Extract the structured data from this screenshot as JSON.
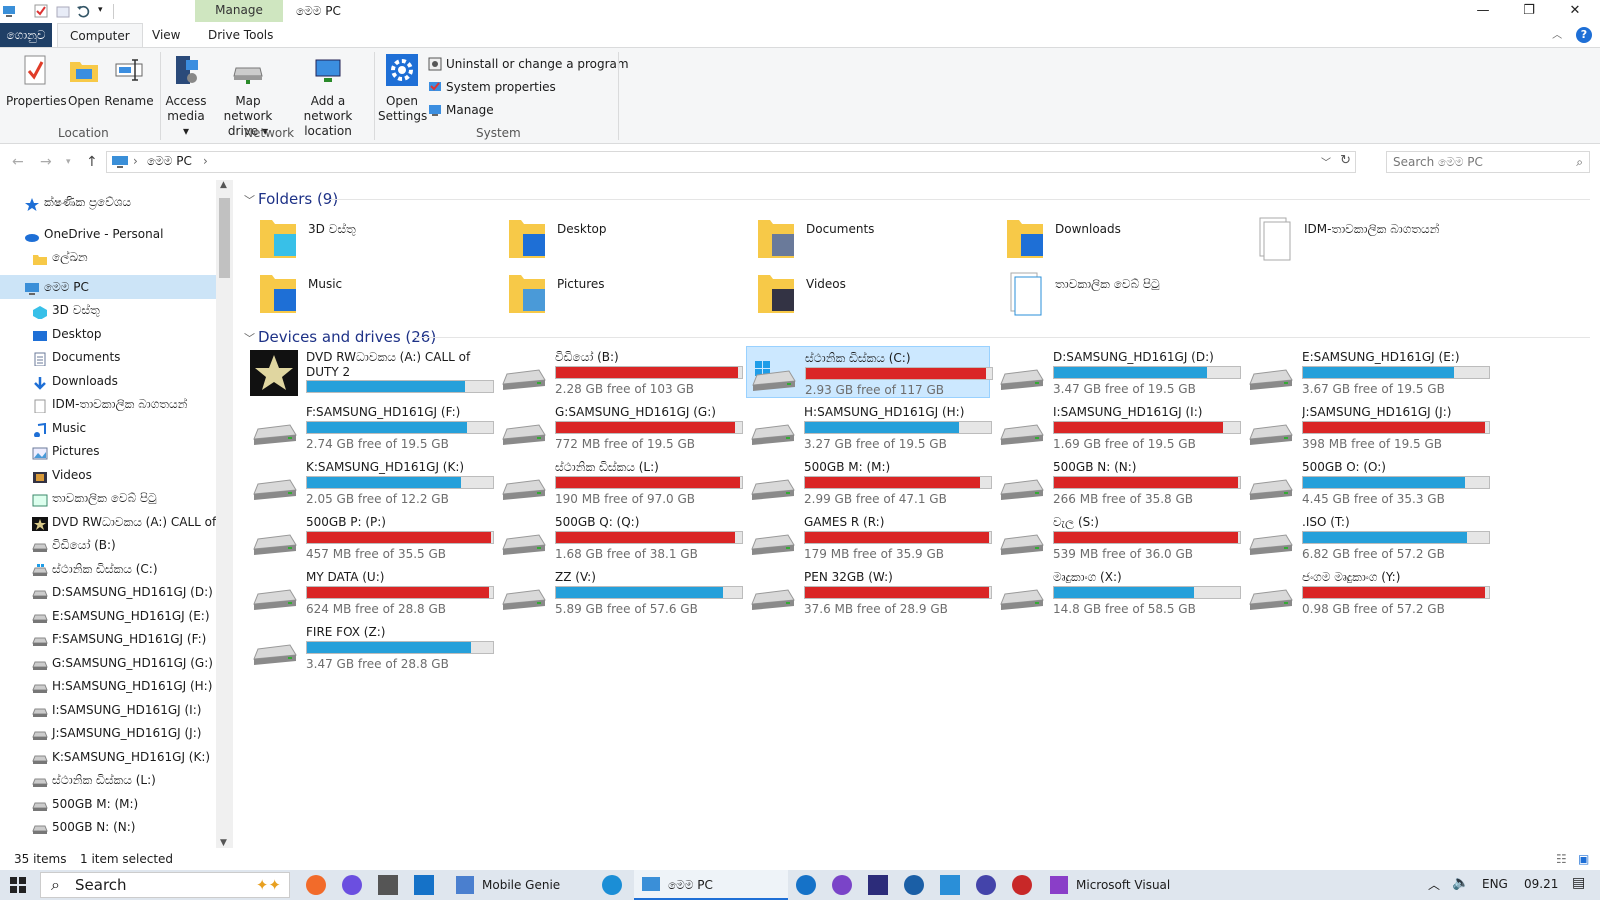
{
  "window": {
    "title": "මෙම PC",
    "context_tab": "Manage",
    "minimize": "—",
    "restore": "❐",
    "close": "✕"
  },
  "tabs": {
    "file": "ගොනුව",
    "computer": "Computer",
    "view": "View",
    "drive_tools": "Drive Tools"
  },
  "ribbon": {
    "location": {
      "label": "Location",
      "buttons": [
        "Properties",
        "Open",
        "Rename"
      ]
    },
    "network": {
      "label": "Network",
      "access": "Access",
      "access2": "media",
      "map": "Map network",
      "map2": "drive",
      "add": "Add a network",
      "add2": "location"
    },
    "system": {
      "label": "System",
      "open": "Open",
      "open2": "Settings",
      "uninstall": "Uninstall or change a program",
      "sysprops": "System properties",
      "manage": "Manage"
    }
  },
  "address": {
    "path": "මෙම PC",
    "search_placeholder": "Search මෙම PC"
  },
  "nav": [
    {
      "label": "ක්ෂණික ප්‍රවේශය",
      "icon": "star-icon",
      "indent": 0
    },
    {
      "label": "OneDrive - Personal",
      "icon": "cloud-icon",
      "indent": 0
    },
    {
      "label": "ලේඛන",
      "icon": "folder-icon",
      "indent": 1
    },
    {
      "label": "මෙම PC",
      "icon": "computer-icon",
      "indent": 0,
      "selected": true
    },
    {
      "label": "3D වස්තු",
      "icon": "cube-icon",
      "indent": 1
    },
    {
      "label": "Desktop",
      "icon": "desktop-icon",
      "indent": 1
    },
    {
      "label": "Documents",
      "icon": "document-icon",
      "indent": 1
    },
    {
      "label": "Downloads",
      "icon": "download-icon",
      "indent": 1
    },
    {
      "label": "IDM-තාවකාලික බාගතයන්",
      "icon": "file-icon",
      "indent": 1
    },
    {
      "label": "Music",
      "icon": "music-icon",
      "indent": 1
    },
    {
      "label": "Pictures",
      "icon": "picture-icon",
      "indent": 1
    },
    {
      "label": "Videos",
      "icon": "video-icon",
      "indent": 1
    },
    {
      "label": "තාවකාලික වෙබ් පිටු",
      "icon": "web-icon",
      "indent": 1
    },
    {
      "label": "DVD RWධාවකය (A:) CALL of DUTY 2",
      "icon": "dvd-icon",
      "indent": 1
    },
    {
      "label": "විඩියෝ (B:)",
      "icon": "drive-icon",
      "indent": 1
    },
    {
      "label": "ස්ථානික ඩිස්කය (C:)",
      "icon": "windows-drive-icon",
      "indent": 1
    },
    {
      "label": "D:SAMSUNG_HD161GJ (D:)",
      "icon": "drive-icon",
      "indent": 1
    },
    {
      "label": "E:SAMSUNG_HD161GJ (E:)",
      "icon": "drive-icon",
      "indent": 1
    },
    {
      "label": "F:SAMSUNG_HD161GJ (F:)",
      "icon": "drive-icon",
      "indent": 1
    },
    {
      "label": "G:SAMSUNG_HD161GJ (G:)",
      "icon": "drive-icon",
      "indent": 1
    },
    {
      "label": "H:SAMSUNG_HD161GJ (H:)",
      "icon": "drive-icon",
      "indent": 1
    },
    {
      "label": "I:SAMSUNG_HD161GJ (I:)",
      "icon": "drive-icon",
      "indent": 1
    },
    {
      "label": "J:SAMSUNG_HD161GJ (J:)",
      "icon": "drive-icon",
      "indent": 1
    },
    {
      "label": "K:SAMSUNG_HD161GJ (K:)",
      "icon": "drive-icon",
      "indent": 1
    },
    {
      "label": "ස්ථානික ඩිස්කය (L:)",
      "icon": "drive-icon",
      "indent": 1
    },
    {
      "label": "500GB M: (M:)",
      "icon": "drive-icon",
      "indent": 1
    },
    {
      "label": "500GB N: (N:)",
      "icon": "drive-icon",
      "indent": 1
    }
  ],
  "folders": {
    "header": "Folders (9)",
    "items": [
      {
        "label": "3D වස්තු",
        "icon": "cube-folder-icon"
      },
      {
        "label": "Desktop",
        "icon": "desktop-folder-icon"
      },
      {
        "label": "Documents",
        "icon": "documents-folder-icon"
      },
      {
        "label": "Downloads",
        "icon": "downloads-folder-icon"
      },
      {
        "label": "IDM-තාවකාලික බාගතයන්",
        "icon": "files-icon"
      },
      {
        "label": "Music",
        "icon": "music-folder-icon"
      },
      {
        "label": "Pictures",
        "icon": "pictures-folder-icon"
      },
      {
        "label": "Videos",
        "icon": "videos-folder-icon"
      },
      {
        "label": "තාවකාලික වෙබ් පිටු",
        "icon": "web-pages-icon"
      }
    ]
  },
  "drives": {
    "header": "Devices and drives (26)",
    "items": [
      {
        "label": "DVD RWධාවකය (A:) CALL of DUTY 2",
        "free": "",
        "used_fraction": 0.85,
        "color": "#26a0da",
        "icon": "dvd-disc-icon"
      },
      {
        "label": "විඩියෝ (B:)",
        "free": "2.28 GB free of 103 GB",
        "used_fraction": 0.98,
        "color": "#da2626",
        "icon": "drive-icon"
      },
      {
        "label": "ස්ථානික ඩිස්කය (C:)",
        "free": "2.93 GB free of 117 GB",
        "used_fraction": 0.97,
        "color": "#da2626",
        "icon": "windows-drive-icon",
        "selected": true
      },
      {
        "label": "D:SAMSUNG_HD161GJ (D:)",
        "free": "3.47 GB free of 19.5 GB",
        "used_fraction": 0.82,
        "color": "#26a0da",
        "icon": "drive-icon"
      },
      {
        "label": "E:SAMSUNG_HD161GJ (E:)",
        "free": "3.67 GB free of 19.5 GB",
        "used_fraction": 0.81,
        "color": "#26a0da",
        "icon": "drive-icon"
      },
      {
        "label": "F:SAMSUNG_HD161GJ (F:)",
        "free": "2.74 GB free of 19.5 GB",
        "used_fraction": 0.86,
        "color": "#26a0da",
        "icon": "drive-icon"
      },
      {
        "label": "G:SAMSUNG_HD161GJ (G:)",
        "free": "772 MB free of 19.5 GB",
        "used_fraction": 0.96,
        "color": "#da2626",
        "icon": "drive-icon"
      },
      {
        "label": "H:SAMSUNG_HD161GJ (H:)",
        "free": "3.27 GB free of 19.5 GB",
        "used_fraction": 0.83,
        "color": "#26a0da",
        "icon": "drive-icon"
      },
      {
        "label": "I:SAMSUNG_HD161GJ (I:)",
        "free": "1.69 GB free of 19.5 GB",
        "used_fraction": 0.91,
        "color": "#da2626",
        "icon": "drive-icon"
      },
      {
        "label": "J:SAMSUNG_HD161GJ (J:)",
        "free": "398 MB free of 19.5 GB",
        "used_fraction": 0.98,
        "color": "#da2626",
        "icon": "drive-icon"
      },
      {
        "label": "K:SAMSUNG_HD161GJ (K:)",
        "free": "2.05 GB free of 12.2 GB",
        "used_fraction": 0.83,
        "color": "#26a0da",
        "icon": "drive-icon"
      },
      {
        "label": "ස්ථානික ඩිස්කය (L:)",
        "free": "190 MB free of 97.0 GB",
        "used_fraction": 0.99,
        "color": "#da2626",
        "icon": "drive-icon"
      },
      {
        "label": "500GB M: (M:)",
        "free": "2.99 GB free of 47.1 GB",
        "used_fraction": 0.94,
        "color": "#da2626",
        "icon": "drive-icon"
      },
      {
        "label": "500GB N: (N:)",
        "free": "266 MB free of 35.8 GB",
        "used_fraction": 0.99,
        "color": "#da2626",
        "icon": "drive-icon"
      },
      {
        "label": "500GB O: (O:)",
        "free": "4.45 GB free of 35.3 GB",
        "used_fraction": 0.87,
        "color": "#26a0da",
        "icon": "drive-icon"
      },
      {
        "label": "500GB P: (P:)",
        "free": "457 MB free of 35.5 GB",
        "used_fraction": 0.99,
        "color": "#da2626",
        "icon": "drive-icon"
      },
      {
        "label": "500GB Q: (Q:)",
        "free": "1.68 GB free of 38.1 GB",
        "used_fraction": 0.96,
        "color": "#da2626",
        "icon": "drive-icon"
      },
      {
        "label": "GAMES R (R:)",
        "free": "179 MB free of 35.9 GB",
        "used_fraction": 0.99,
        "color": "#da2626",
        "icon": "drive-icon"
      },
      {
        "label": "වැල (S:)",
        "free": "539 MB free of 36.0 GB",
        "used_fraction": 0.99,
        "color": "#da2626",
        "icon": "drive-icon"
      },
      {
        "label": ".ISO (T:)",
        "free": "6.82 GB free of 57.2 GB",
        "used_fraction": 0.88,
        "color": "#26a0da",
        "icon": "drive-icon"
      },
      {
        "label": "MY DATA (U:)",
        "free": "624 MB free of 28.8 GB",
        "used_fraction": 0.98,
        "color": "#da2626",
        "icon": "drive-icon"
      },
      {
        "label": "ZZ (V:)",
        "free": "5.89 GB free of 57.6 GB",
        "used_fraction": 0.9,
        "color": "#26a0da",
        "icon": "drive-icon"
      },
      {
        "label": "PEN 32GB (W:)",
        "free": "37.6 MB free of 28.9 GB",
        "used_fraction": 0.99,
        "color": "#da2626",
        "icon": "drive-icon"
      },
      {
        "label": "මෘදුකාංග (X:)",
        "free": "14.8 GB free of 58.5 GB",
        "used_fraction": 0.75,
        "color": "#26a0da",
        "icon": "drive-icon"
      },
      {
        "label": "ජංගම මෘදුකාංග (Y:)",
        "free": "0.98 GB free of 57.2 GB",
        "used_fraction": 0.98,
        "color": "#da2626",
        "icon": "drive-icon"
      },
      {
        "label": "FIRE FOX (Z:)",
        "free": "3.47 GB free of 28.8 GB",
        "used_fraction": 0.88,
        "color": "#26a0da",
        "icon": "drive-icon"
      }
    ]
  },
  "status": {
    "items": "35 items",
    "selected": "1 item selected"
  },
  "taskbar": {
    "search": "Search",
    "mobile_genie": "Mobile Genie",
    "explorer": "මෙම PC",
    "vs": "Microsoft Visual Studi...",
    "lang": "ENG",
    "time": "09.21"
  },
  "colors": {
    "accent": "#26a0da",
    "warning": "#da2626",
    "selection": "#cce8ff",
    "file_tab": "#1f3f66",
    "manage_tab": "#cfe6c0"
  }
}
